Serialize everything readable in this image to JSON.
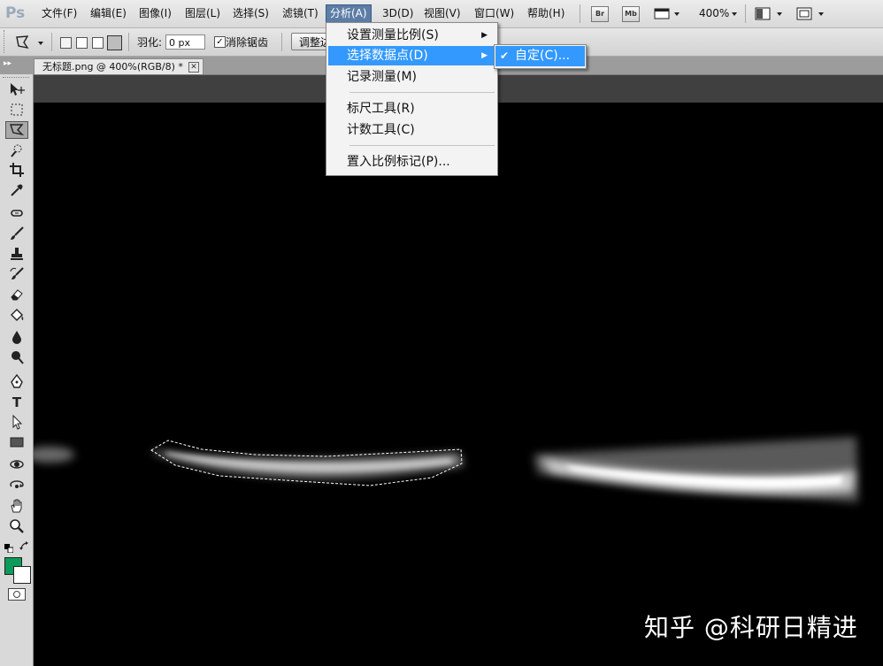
{
  "menubar": {
    "logo": "Ps",
    "items": [
      "文件(F)",
      "编辑(E)",
      "图像(I)",
      "图层(L)",
      "选择(S)",
      "滤镜(T)",
      "分析(A)",
      "3D(D)",
      "视图(V)",
      "窗口(W)",
      "帮助(H)"
    ],
    "active_item": "分析(A)",
    "bridge_label": "Br",
    "minibridge_label": "Mb",
    "zoom": "400%"
  },
  "options": {
    "feather_label": "羽化:",
    "feather_value": "0 px",
    "antialias_label": "消除锯齿",
    "antialias_checked": "✓",
    "refine_edge_label": "调整边缘..."
  },
  "document": {
    "tab_title": "无标题.png @ 400%(RGB/8) *",
    "close_glyph": "✕"
  },
  "dropdown": {
    "items": [
      {
        "label": "设置测量比例(S)",
        "submenu": "▶"
      },
      {
        "label": "选择数据点(D)",
        "submenu": "▶"
      },
      {
        "label": "记录测量(M)"
      },
      {
        "label": "标尺工具(R)"
      },
      {
        "label": "计数工具(C)"
      },
      {
        "label": "置入比例标记(P)..."
      }
    ],
    "highlighted_index": 1
  },
  "submenu": {
    "label": "自定(C)...",
    "check": "✔"
  },
  "toolbox": {
    "tools": [
      "move-tool",
      "marquee-tool",
      "polygonal-lasso-tool",
      "quick-selection-tool",
      "crop-tool",
      "eyedropper-tool",
      "healing-brush-tool",
      "brush-tool",
      "clone-stamp-tool",
      "history-brush-tool",
      "eraser-tool",
      "paint-bucket-tool",
      "blur-tool",
      "dodge-tool",
      "pen-tool",
      "type-tool",
      "path-selection-tool",
      "rectangle-tool",
      "3d-rotate-tool",
      "3d-orbit-tool",
      "hand-tool",
      "zoom-tool"
    ],
    "active_tool": "polygonal-lasso-tool",
    "type_tool_glyph": "T",
    "foreground_color": "#0b9b5a",
    "background_color": "#ffffff"
  },
  "canvas": {
    "background": "#000000",
    "watermark": "知乎 @科研日精进"
  },
  "colors": {
    "menu_highlight": "#3399ff",
    "active_menu": "#5d7da6"
  }
}
